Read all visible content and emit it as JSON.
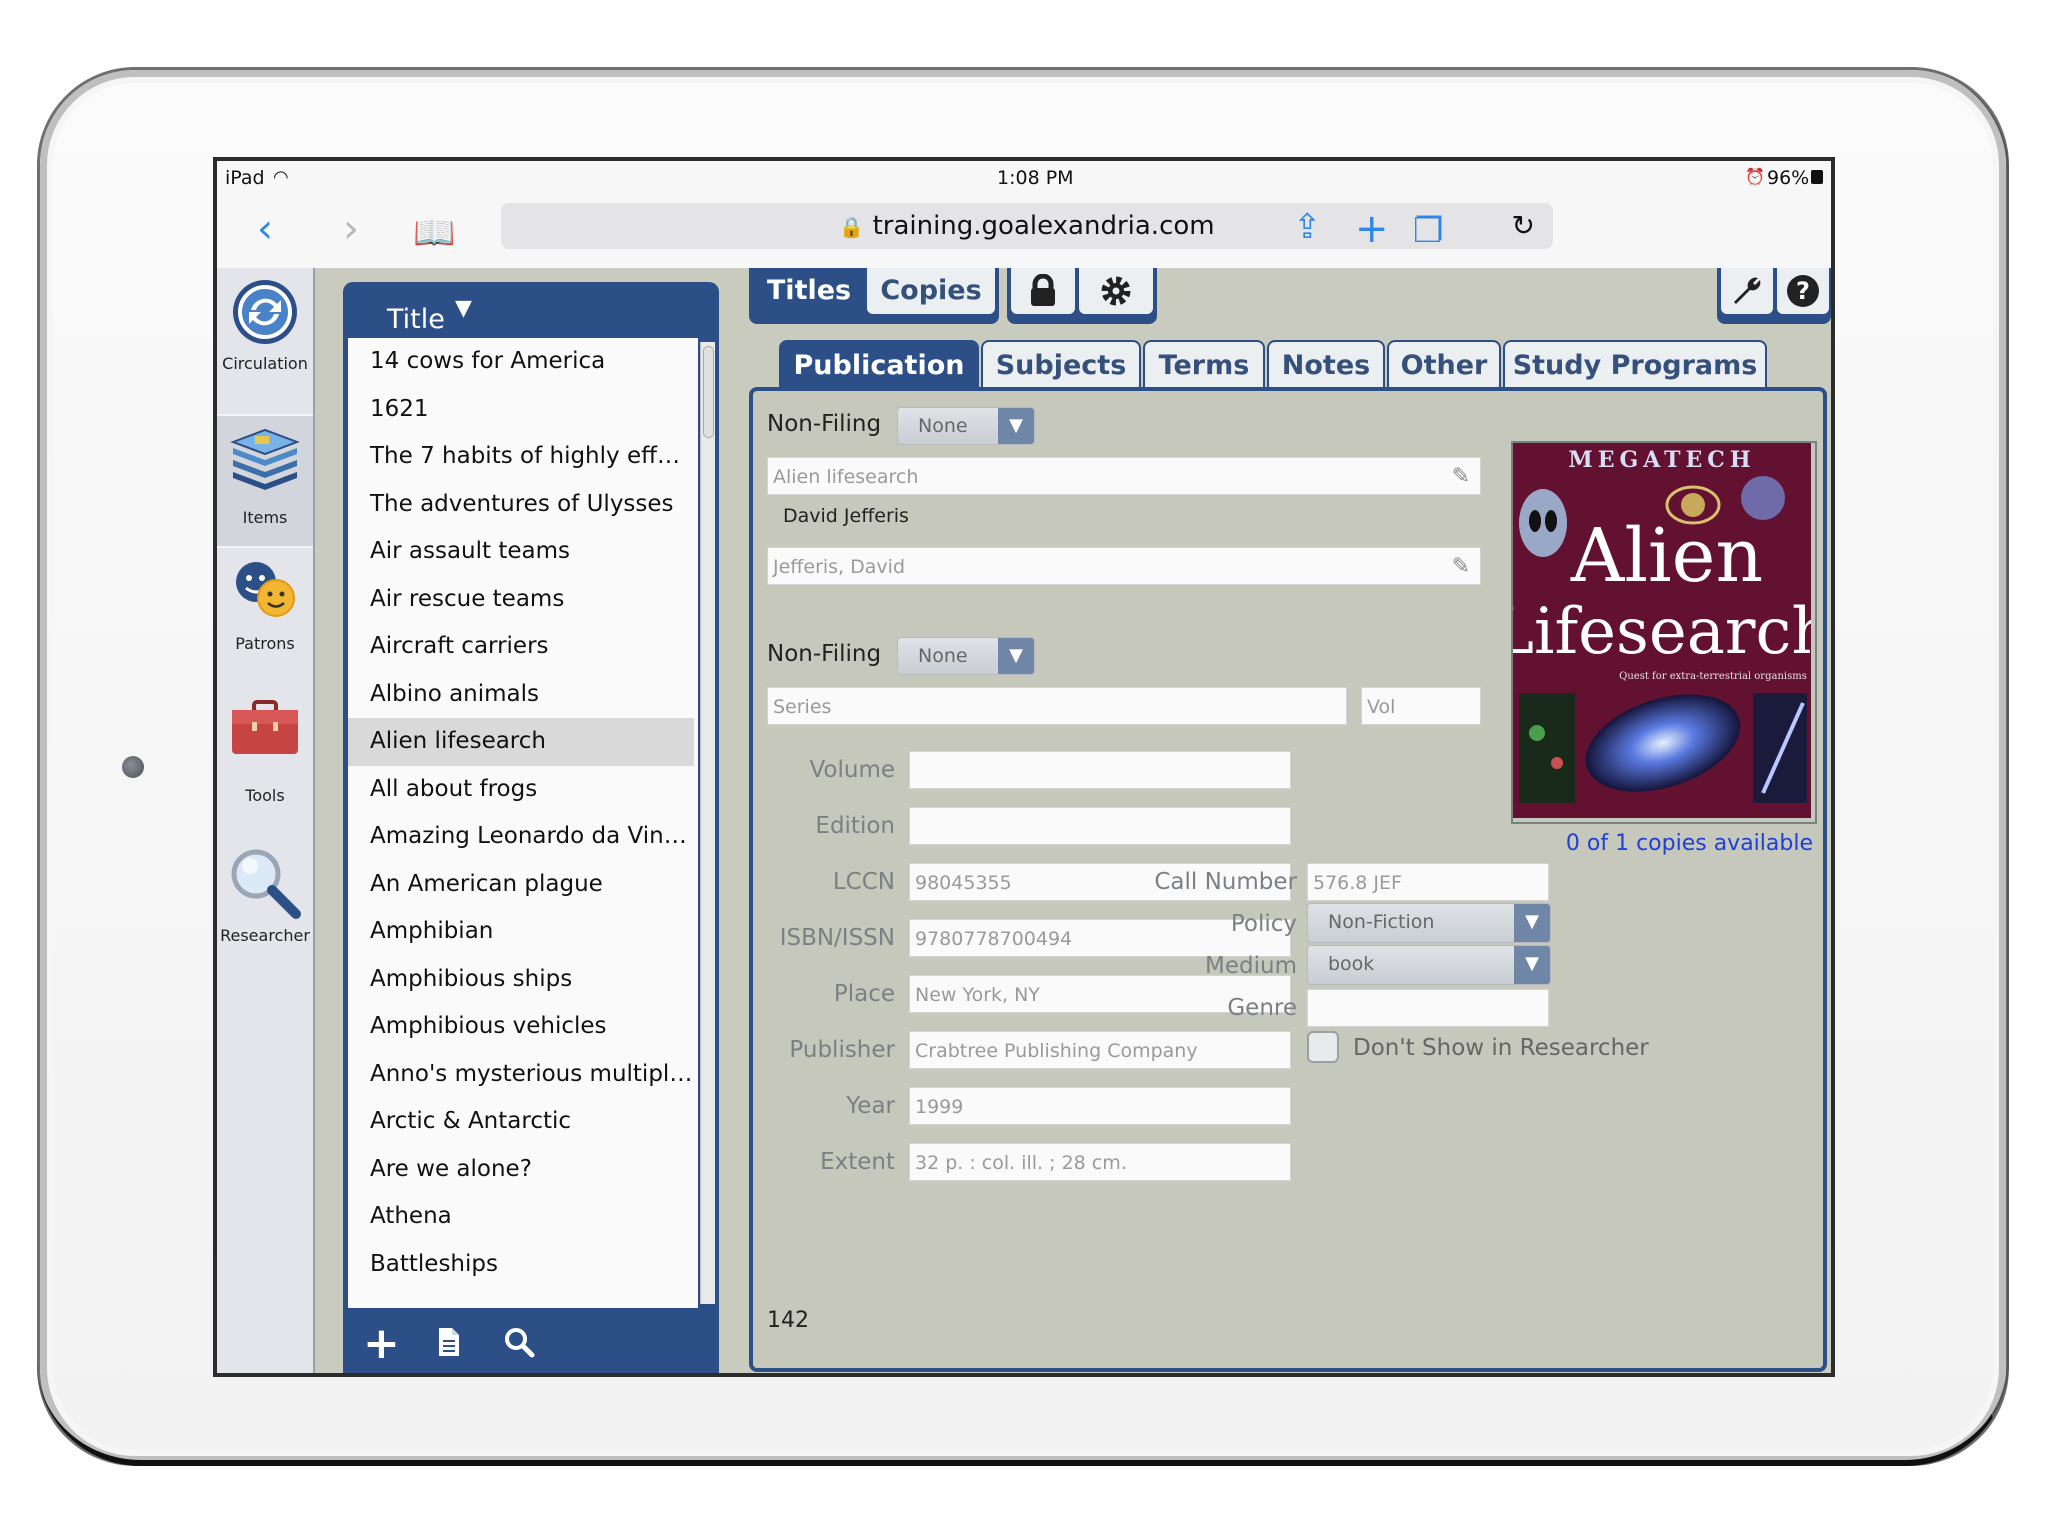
{
  "status_bar": {
    "device": "iPad",
    "time": "1:08 PM",
    "battery": "96%"
  },
  "browser": {
    "url": "training.goalexandria.com"
  },
  "app_nav": [
    {
      "label": "Circulation",
      "icon": "circulation-icon"
    },
    {
      "label": "Items",
      "icon": "items-icon"
    },
    {
      "label": "Patrons",
      "icon": "patrons-icon"
    },
    {
      "label": "Tools",
      "icon": "tools-icon"
    },
    {
      "label": "Researcher",
      "icon": "researcher-icon"
    }
  ],
  "list": {
    "header": "Title",
    "items": [
      "14 cows for America",
      "1621",
      "The 7 habits of highly effec...",
      "The adventures of Ulysses",
      "Air assault teams",
      "Air rescue teams",
      "Aircraft carriers",
      "Albino animals",
      "Alien lifesearch",
      "All about frogs",
      "Amazing Leonardo da Vinci ...",
      "An American plague",
      "Amphibian",
      "Amphibious ships",
      "Amphibious vehicles",
      "Anno's mysterious multiplyi...",
      "Arctic & Antarctic",
      "Are we alone?",
      "Athena",
      "Battleships"
    ],
    "selected_index": 8
  },
  "top_tabs": {
    "titles": "Titles",
    "copies": "Copies"
  },
  "sub_tabs": [
    "Publication",
    "Subjects",
    "Terms",
    "Notes",
    "Other",
    "Study Programs"
  ],
  "form": {
    "non_filing_label": "Non-Filing",
    "non_filing_value": "None",
    "title_value": "Alien lifesearch",
    "author_display": "David Jefferis",
    "author_value": "Jefferis, David",
    "series_placeholder": "Series",
    "vol_placeholder": "Vol",
    "volume_label": "Volume",
    "edition_label": "Edition",
    "lccn_label": "LCCN",
    "lccn_value": "98045355",
    "isbn_label": "ISBN/ISSN",
    "isbn_value": "9780778700494",
    "place_label": "Place",
    "place_value": "New York, NY",
    "publisher_label": "Publisher",
    "publisher_value": "Crabtree Publishing Company",
    "year_label": "Year",
    "year_value": "1999",
    "extent_label": "Extent",
    "extent_value": "32 p. : col. ill. ; 28 cm.",
    "copies_available": "0 of 1 copies available",
    "call_number_label": "Call Number",
    "call_number_value": "576.8 JEF",
    "policy_label": "Policy",
    "policy_value": "Non-Fiction",
    "medium_label": "Medium",
    "medium_value": "book",
    "genre_label": "Genre",
    "dont_show_label": "Don't Show in Researcher",
    "record_number": "142"
  },
  "cover": {
    "brand": "MEGATECH",
    "line1": "Alien",
    "line2": "Lifesearch",
    "tagline": "Quest for extra-terrestrial organisms"
  },
  "colors": {
    "navy": "#2c4f87",
    "panel_bg": "#c5c8bb",
    "link_blue": "#1f3fd6"
  }
}
